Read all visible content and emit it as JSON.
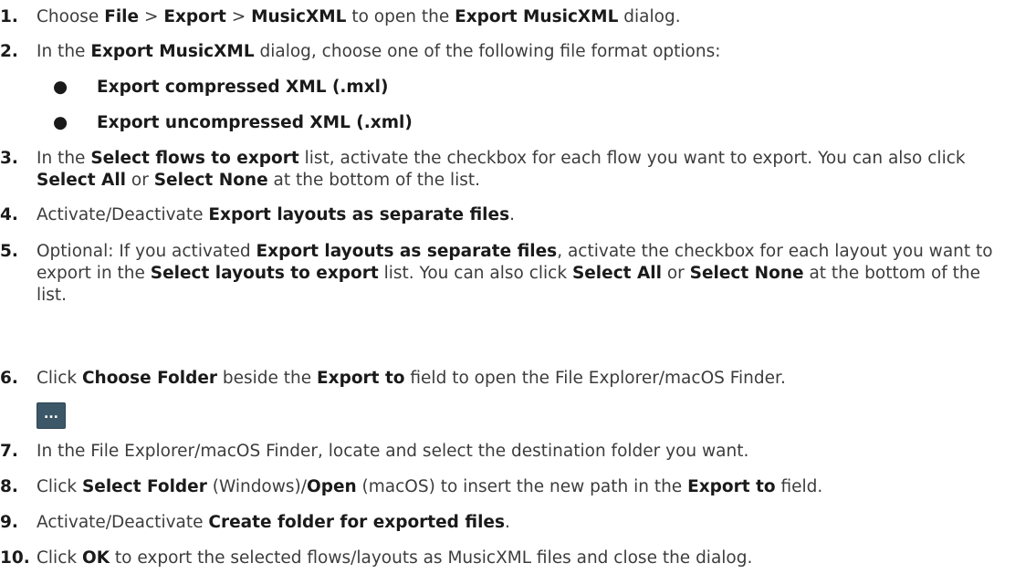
{
  "steps": [
    {
      "num": "1.",
      "parts": [
        {
          "t": "Choose "
        },
        {
          "t": "File",
          "b": true
        },
        {
          "t": " > "
        },
        {
          "t": "Export",
          "b": true
        },
        {
          "t": " > "
        },
        {
          "t": "MusicXML",
          "b": true
        },
        {
          "t": " to open the "
        },
        {
          "t": "Export MusicXML",
          "b": true
        },
        {
          "t": " dialog."
        }
      ]
    },
    {
      "num": "2.",
      "parts": [
        {
          "t": "In the "
        },
        {
          "t": "Export MusicXML",
          "b": true
        },
        {
          "t": " dialog, choose one of the following file format options:"
        }
      ],
      "bullets": [
        "Export compressed XML (.mxl)",
        "Export uncompressed XML (.xml)"
      ]
    },
    {
      "num": "3.",
      "parts": [
        {
          "t": "In the "
        },
        {
          "t": "Select flows to export",
          "b": true
        },
        {
          "t": " list, activate the checkbox for each flow you want to export. You can also click "
        },
        {
          "t": "Select All",
          "b": true
        },
        {
          "t": " or "
        },
        {
          "t": "Select None",
          "b": true
        },
        {
          "t": " at the bottom of the list."
        }
      ]
    },
    {
      "num": "4.",
      "parts": [
        {
          "t": "Activate/Deactivate "
        },
        {
          "t": "Export layouts as separate files",
          "b": true
        },
        {
          "t": "."
        }
      ]
    },
    {
      "num": "5.",
      "parts": [
        {
          "t": "Optional: If you activated "
        },
        {
          "t": "Export layouts as separate files",
          "b": true
        },
        {
          "t": ", activate the checkbox for each layout you want to export in the "
        },
        {
          "t": "Select layouts to export",
          "b": true
        },
        {
          "t": " list. You can also click "
        },
        {
          "t": "Select All",
          "b": true
        },
        {
          "t": " or "
        },
        {
          "t": "Select None",
          "b": true
        },
        {
          "t": " at the bottom of the list."
        }
      ]
    },
    {
      "num": "6.",
      "parts": [
        {
          "t": "Click "
        },
        {
          "t": "Choose Folder",
          "b": true
        },
        {
          "t": " beside the "
        },
        {
          "t": "Export to",
          "b": true
        },
        {
          "t": " field to open the File Explorer/macOS Finder."
        }
      ]
    },
    {
      "num": "7.",
      "parts": [
        {
          "t": "In the File Explorer/macOS Finder, locate and select the destination folder you want."
        }
      ]
    },
    {
      "num": "8.",
      "parts": [
        {
          "t": "Click "
        },
        {
          "t": "Select Folder",
          "b": true
        },
        {
          "t": " (Windows)/"
        },
        {
          "t": "Open",
          "b": true
        },
        {
          "t": " (macOS) to insert the new path in the "
        },
        {
          "t": "Export to",
          "b": true
        },
        {
          "t": " field."
        }
      ]
    },
    {
      "num": "9.",
      "parts": [
        {
          "t": "Activate/Deactivate "
        },
        {
          "t": "Create folder for exported files",
          "b": true
        },
        {
          "t": "."
        }
      ]
    },
    {
      "num": "10.",
      "parts": [
        {
          "t": "Click "
        },
        {
          "t": "OK",
          "b": true
        },
        {
          "t": " to export the selected flows/layouts as MusicXML files and close the dialog."
        }
      ]
    }
  ],
  "choose_folder_button": {
    "label": "...",
    "icon": "ellipsis-icon"
  },
  "colors": {
    "text": "#3c3c3c",
    "bold_text": "#1a1a1a",
    "button_bg": "#3c5868"
  }
}
